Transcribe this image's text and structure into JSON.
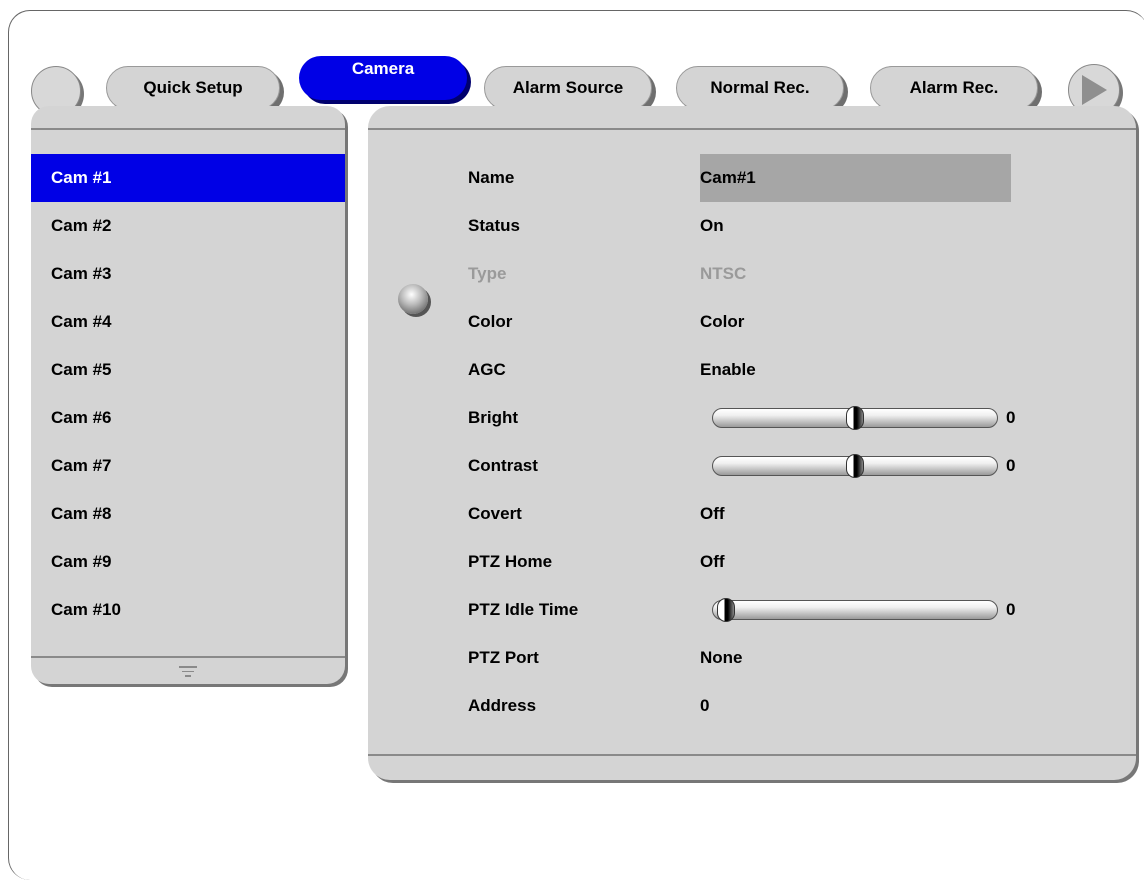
{
  "tabs": [
    {
      "label": "Quick Setup",
      "active": false
    },
    {
      "label": "Camera",
      "active": true
    },
    {
      "label": "Alarm Source",
      "active": false
    },
    {
      "label": "Normal Rec.",
      "active": false
    },
    {
      "label": "Alarm Rec.",
      "active": false
    }
  ],
  "cameras": [
    "Cam #1",
    "Cam #2",
    "Cam #3",
    "Cam #4",
    "Cam #5",
    "Cam #6",
    "Cam #7",
    "Cam #8",
    "Cam #9",
    "Cam #10"
  ],
  "selected_camera": "Cam #1",
  "settings": {
    "name": {
      "label": "Name",
      "value": "Cam#1"
    },
    "status": {
      "label": "Status",
      "value": "On"
    },
    "type": {
      "label": "Type",
      "value": "NTSC"
    },
    "color": {
      "label": "Color",
      "value": "Color"
    },
    "agc": {
      "label": "AGC",
      "value": "Enable"
    },
    "bright": {
      "label": "Bright",
      "value": "0",
      "level": 0.5
    },
    "contrast": {
      "label": "Contrast",
      "value": "0",
      "level": 0.5
    },
    "covert": {
      "label": "Covert",
      "value": "Off"
    },
    "ptz_home": {
      "label": "PTZ Home",
      "value": "Off"
    },
    "ptz_idle_time": {
      "label": "PTZ Idle Time",
      "value": "0",
      "level": 0.0
    },
    "ptz_port": {
      "label": "PTZ Port",
      "value": "None"
    },
    "address": {
      "label": "Address",
      "value": "0"
    }
  },
  "colors": {
    "accent": "#0000e6",
    "panel": "#d4d4d4",
    "disabled": "#9a9a9a"
  },
  "icons": {
    "menu": "circle-button",
    "next": "play-arrow-icon",
    "scroll": "scroll-indicator-icon",
    "cursor": "selection-ball-icon"
  }
}
